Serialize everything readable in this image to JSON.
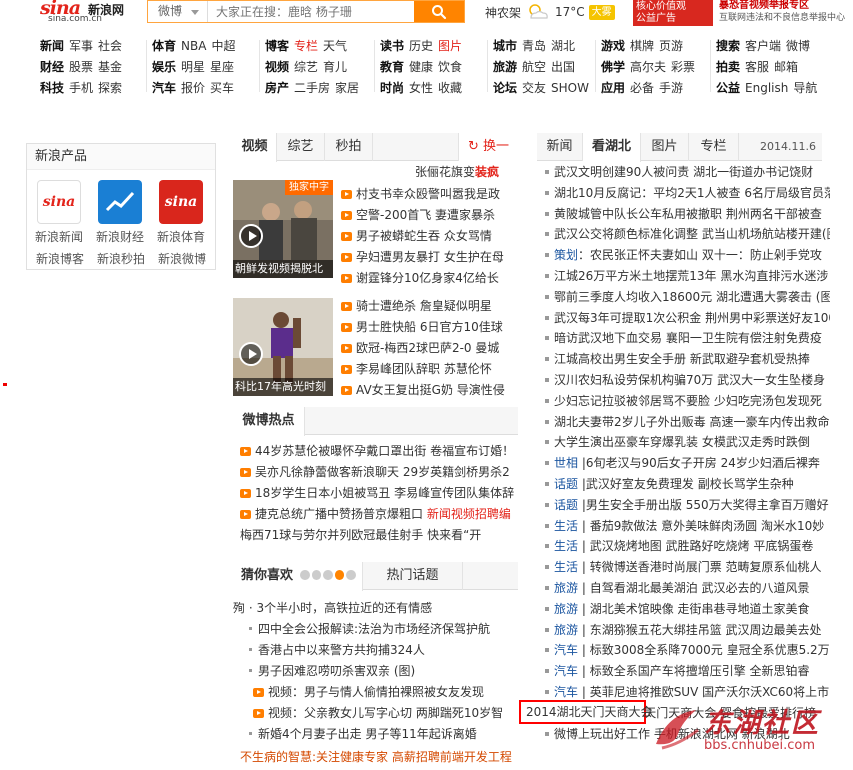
{
  "logo": {
    "brand": "sina",
    "brand_cn": "新浪网",
    "domain": "sina.com.cn"
  },
  "search": {
    "category": "微博",
    "placeholder": "大家正在搜：鹿晗 杨子珊"
  },
  "weather": {
    "city": "神农架",
    "temp": "17°C",
    "badge": "大雾",
    "icon": "cloud-sun-icon"
  },
  "top_ads": {
    "ad1": [
      "核心价值观",
      "公益广告"
    ],
    "ad2_main": "暴恐音视频举报专区",
    "ad2_sub": "互联网违法和不良信息举报中心"
  },
  "nav": [
    {
      "rows": [
        [
          "新闻",
          "军事",
          "社会"
        ],
        [
          "财经",
          "股票",
          "基金"
        ],
        [
          "科技",
          "手机",
          "探索"
        ]
      ]
    },
    {
      "rows": [
        [
          "体育",
          "NBA",
          "中超"
        ],
        [
          "娱乐",
          "明星",
          "星座"
        ],
        [
          "汽车",
          "报价",
          "买车"
        ]
      ]
    },
    {
      "rows": [
        [
          "博客",
          "专栏",
          "天气"
        ],
        [
          "视频",
          "综艺",
          "育儿"
        ],
        [
          "房产",
          "二手房",
          "家居"
        ]
      ]
    },
    {
      "rows": [
        [
          "读书",
          "历史",
          "图片"
        ],
        [
          "教育",
          "健康",
          "饮食"
        ],
        [
          "时尚",
          "女性",
          "收藏"
        ]
      ]
    },
    {
      "rows": [
        [
          "城市",
          "青岛",
          "湖北"
        ],
        [
          "旅游",
          "航空",
          "出国"
        ],
        [
          "论坛",
          "交友",
          "SHOW"
        ]
      ]
    },
    {
      "rows": [
        [
          "游戏",
          "棋牌",
          "页游"
        ],
        [
          "佛学",
          "高尔夫",
          "彩票"
        ],
        [
          "应用",
          "必备",
          "手游"
        ]
      ]
    },
    {
      "rows": [
        [
          "搜索",
          "客户端",
          "微博"
        ],
        [
          "拍卖",
          "客服",
          "邮箱"
        ],
        [
          "公益",
          "English",
          "导航"
        ]
      ]
    }
  ],
  "products": {
    "title": "新浪产品",
    "items": [
      {
        "label": "新浪新闻",
        "icon": "sina-news-icon",
        "color": "#ffffff"
      },
      {
        "label": "新浪财经",
        "icon": "sina-finance-icon",
        "color": "#1a7fd4"
      },
      {
        "label": "新浪体育",
        "icon": "sina-sports-icon",
        "color": "#d9261c"
      }
    ],
    "links": [
      "新浪博客",
      "新浪秒拍",
      "新浪微博"
    ]
  },
  "video": {
    "tabs": [
      "视频",
      "综艺",
      "秒拍"
    ],
    "refresh": "换一",
    "headline_pre": "张俪花旗变",
    "headline_hot": "装疯",
    "thumbs": [
      {
        "caption": "朝鲜发视频揭脱北",
        "tag": "独家中字"
      },
      {
        "caption": "科比17年高光时刻",
        "tag": ""
      }
    ],
    "list1": [
      "村支书幸众殴警叫嚣我是政",
      "空警-200首飞 妻遭家暴杀",
      "男子被蟒蛇生吞 众女骂情",
      "孕妇遭男友暴打 女生护在母",
      "谢霆锋分10亿身家4亿给长"
    ],
    "list2": [
      "骑士遭绝杀 詹皇疑似明星",
      "男士胜快船 6日官方10佳球",
      "欧冠-梅西2球巴萨2-0 曼城",
      "李易峰团队辞职 苏慧伦怀",
      "AV女王复出挺G奶 导演性侵"
    ]
  },
  "weibo": {
    "tab": "微博热点",
    "items": [
      {
        "pre": "44岁苏慧伦被曝怀孕戴口罩出街 卷福宣布订婚！",
        "hot": ""
      },
      {
        "pre": "吴亦凡徐静蕾做客新浪聊天 29岁英籍剑桥男杀2",
        "hot": ""
      },
      {
        "pre": "18岁学生日本小姐被骂丑 李易峰宣传团队集体辞",
        "hot": ""
      },
      {
        "pre": "捷克总统广播中赞扬普京爆粗口 ",
        "hot": "新闻视频招聘编"
      }
    ],
    "plain": "梅西71球与劳尔并列欧冠最佳射手 快来看“开"
  },
  "guess": {
    "tabs": [
      "猜你喜欢",
      "热门话题"
    ],
    "items": [
      {
        "text": "殉 · 3个半小时，高铁拉近的还有情感",
        "video": false
      },
      {
        "text": "四中全会公报解读:法治为市场经济保驾护航",
        "video": false
      },
      {
        "text": "香港占中以来警方共拘捕324人",
        "video": false
      },
      {
        "text": "男子因难忍唠叨杀害双亲 (图)",
        "video": false
      },
      {
        "text": "视频：男子与情人偷情拍裸照被女友发现",
        "video": true
      },
      {
        "text": "视频：父亲教女儿写字心切 两脚踹死10岁智",
        "video": true
      },
      {
        "text": "新婚4个月妻子出走 男子等11年起诉离婚",
        "video": false
      }
    ],
    "bottom": "不生病的智慧:关注健康专家 高薪招聘前端开发工程"
  },
  "right": {
    "tabs": [
      "新闻",
      "看湖北",
      "图片",
      "专栏"
    ],
    "date": "2014.11.6",
    "items": [
      "武汉文明创建90人被问责 湖北一街道办书记饶财",
      "湖北10月反腐记：平均2天1人被查 6名厅局级官员落",
      "黄陂城管中队长公车私用被撤职 荆州两名干部被查",
      "武汉公交将颜色标准化调整 武当山机场航站楼开建(图)",
      "策划：农民张正怀夫妻如山 双十一：防止剁手党攻",
      "江城26万平方米土地摆荒13年 黑水沟直排污水迷涉",
      "鄂前三季度人均收入18600元 湖北遭遇大雾袭击 (图)",
      "武汉每3年可提取1次公积金 荆州男中彩票送好友100",
      "暗访武汉地下血交易 襄阳一卫生院有偿注射免费疫",
      "江城高校出男生安全手册 新武取避孕套机受热捧",
      "汉川农妇私设劳保机构骗70万 武汉大一女生坠楼身",
      "少妇忘记拉驳被邻居骂不要脸 少妇吃完汤包发现死",
      "湖北夫妻带2岁儿子外出贩毒 高速一豪车内传出救命",
      "大学生演出巫豪车穿爆乳装 女模武汉走秀时跌倒",
      "世相 |6旬老汉与90后女子开房 24岁少妇酒后裸奔",
      "话题 |武汉好室友免费理发 副校长骂学生杂种",
      "话题 |男生安全手册出版 550万大奖得主拿百万赠好",
      "生活 | 番茄9款做法 意外美味鲜肉汤圆 淘米水10妙",
      "生活 | 武汉烧烤地图 武胜路好吃烧烤 平底锅蛋卷",
      "生活 | 转微博送香港时尚展门票 范畴复原系仙桃人",
      "旅游 | 自驾看湖北最美湖泊 武汉必去的八道风景",
      "旅游 | 湖北美术馆映像 走街串巷寻地道土家美食",
      "旅游 | 东湖猕猴五花大绑挂吊篮 武汉周边最美去处",
      "汽车 | 标致3008全系降7000元 皇冠全系优惠5.2万",
      "汽车 | 标致全系国产车将擅增压引擎 全新思铂睿",
      "汽车 | 英菲尼迪将推欧SUV 国产沃尔沃XC60将上市",
      "汽车 | 2014湖北天门天商大会 婴食控最爱排行榜",
      "微博上玩出好工作 手机新浪湖北网 新浪湖北"
    ],
    "blue_tags": [
      "策划",
      "世相",
      "话题",
      "生活",
      "旅游",
      "汽车"
    ]
  },
  "callout": "2014湖北天门天商大会",
  "watermark": {
    "title": "东湖社区",
    "url": "bbs.cnhubei.com"
  }
}
